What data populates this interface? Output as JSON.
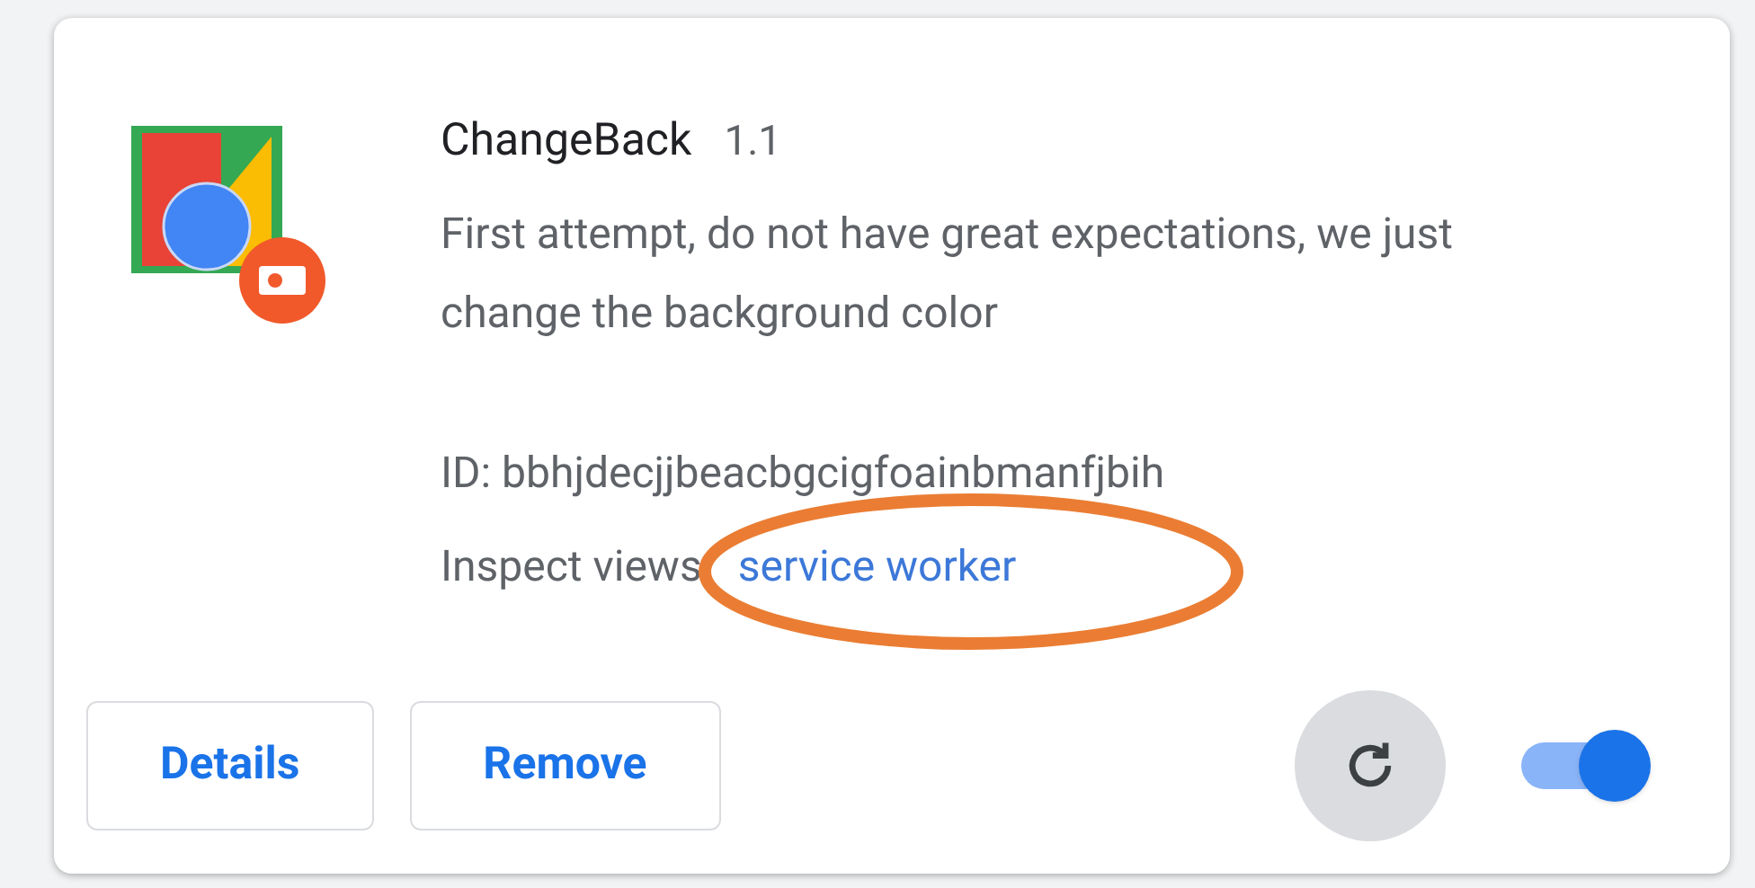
{
  "extension": {
    "name": "ChangeBack",
    "version": "1.1",
    "description": "First attempt, do not have great expectations, we just change the background color",
    "id_line": "ID: bbhjdecjjbeacbgcigfoainbmanfjbih",
    "inspect_label": "Inspect views",
    "inspect_link": "service worker",
    "enabled": true
  },
  "buttons": [
    {
      "label": "Details"
    },
    {
      "label": "Remove"
    }
  ],
  "annotation": {
    "kind": "ellipse",
    "color": "#ea7d33"
  }
}
